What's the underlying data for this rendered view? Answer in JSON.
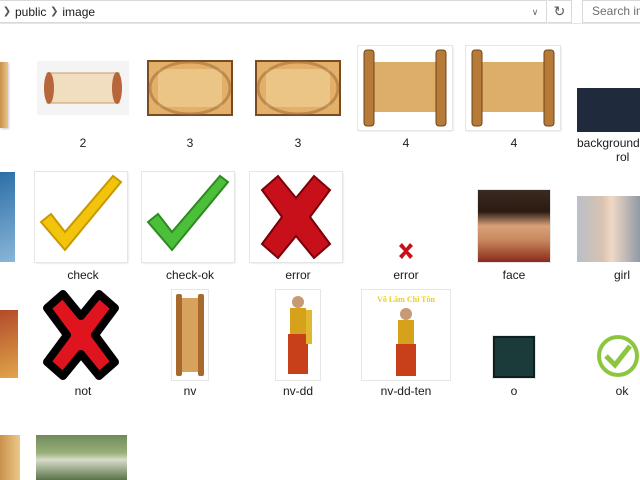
{
  "address_bar": {
    "breadcrumbs": [
      "public",
      "image"
    ],
    "search_placeholder": "Search im"
  },
  "files": [
    {
      "name": "2"
    },
    {
      "name": "3"
    },
    {
      "name": "3"
    },
    {
      "name": "4"
    },
    {
      "name": "4"
    },
    {
      "name": "background",
      "name_line2": "rol"
    },
    {
      "name": "check"
    },
    {
      "name": "check-ok"
    },
    {
      "name": "error"
    },
    {
      "name": "error"
    },
    {
      "name": "face"
    },
    {
      "name": "girl"
    },
    {
      "name": "not"
    },
    {
      "name": "nv"
    },
    {
      "name": "nv-dd"
    },
    {
      "name": "nv-dd-ten",
      "thumb_text": "Võ Lâm Chi Tôn"
    },
    {
      "name": "o"
    },
    {
      "name": "ok"
    }
  ],
  "colors": {
    "parchment": "#d9a55a",
    "parchment_dark": "#8a5a2b",
    "check_yellow": "#f2c40c",
    "check_green": "#4cbf3a",
    "cross_red": "#c8101a",
    "navy": "#1f2a3c",
    "teal_dark": "#1b3a3a"
  }
}
